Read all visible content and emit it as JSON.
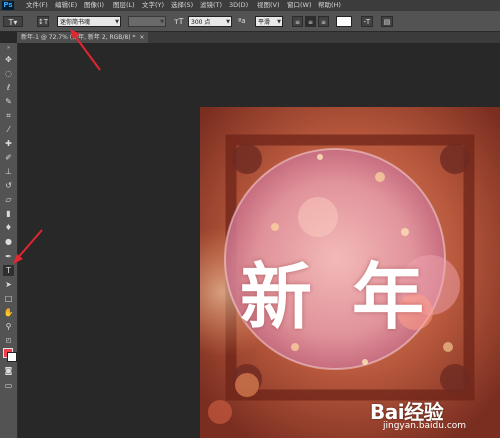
{
  "app": {
    "logo": "Ps"
  },
  "menu": [
    "文件(F)",
    "编辑(E)",
    "图像(I)",
    "图层(L)",
    "文字(Y)",
    "选择(S)",
    "滤镜(T)",
    "3D(D)",
    "视图(V)",
    "窗口(W)",
    "帮助(H)"
  ],
  "options": {
    "font_family": "迷你简书魂",
    "font_style": "",
    "font_size": "300 点",
    "antialias": "平滑",
    "color": "#ffffff"
  },
  "document_tab": {
    "title": "新年-1 @ 72.7% (新年, 新年 2, RGB/8) *",
    "close": "×"
  },
  "artwork": {
    "text_1": "新",
    "text_2": "年"
  },
  "colors": {
    "foreground": "#ef3e4a",
    "background": "#ffffff",
    "annotation": "#e0262f"
  },
  "watermark": {
    "logo": "Bai经验",
    "url": "jingyan.baidu.com"
  }
}
